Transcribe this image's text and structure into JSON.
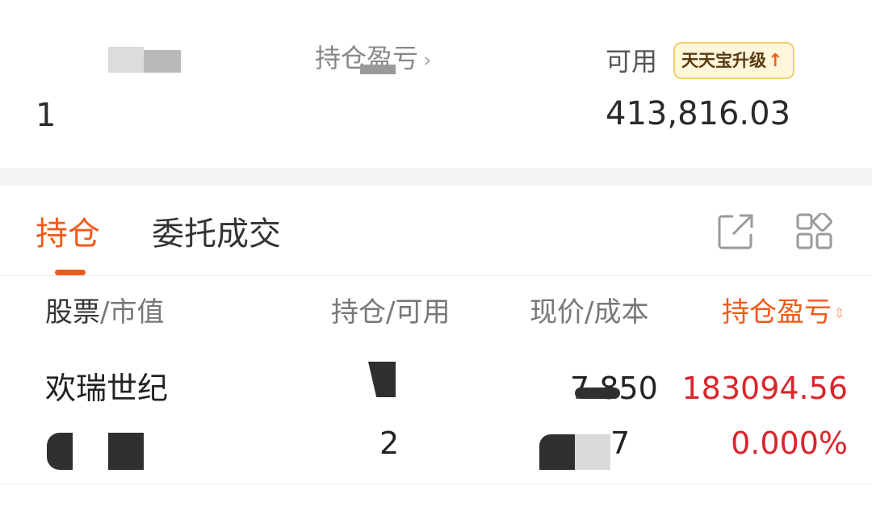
{
  "summary": {
    "market_value_label": "",
    "market_value": "1",
    "position_pnl_label": "持仓盈亏",
    "position_pnl_chevron": "›",
    "available_label": "可用",
    "available_value": "413,816.03",
    "badge_text": "天天宝升级",
    "badge_arrow": "↑"
  },
  "tabs": {
    "holdings": "持仓",
    "orders": "委托成交"
  },
  "icons": {
    "share": "share-external-icon",
    "grid": "grid-layout-icon"
  },
  "table": {
    "headers": {
      "stock_main": "股票",
      "stock_sub": "/市值",
      "hold": "持仓/可用",
      "price": "现价/成本",
      "pnl": "持仓盈亏",
      "sort_icon": "⇕"
    },
    "rows": [
      {
        "name": "欢瑞世纪",
        "price": "7.850",
        "pnl": "183094.56",
        "pnl_rate": "0.000%",
        "hold_partial": "2",
        "cost_partial": "7"
      }
    ]
  },
  "colors": {
    "accent": "#f05a1a",
    "loss_profit": "#d9262c",
    "badge_bg": "#fff6dc",
    "badge_border": "#f2cf6a"
  }
}
